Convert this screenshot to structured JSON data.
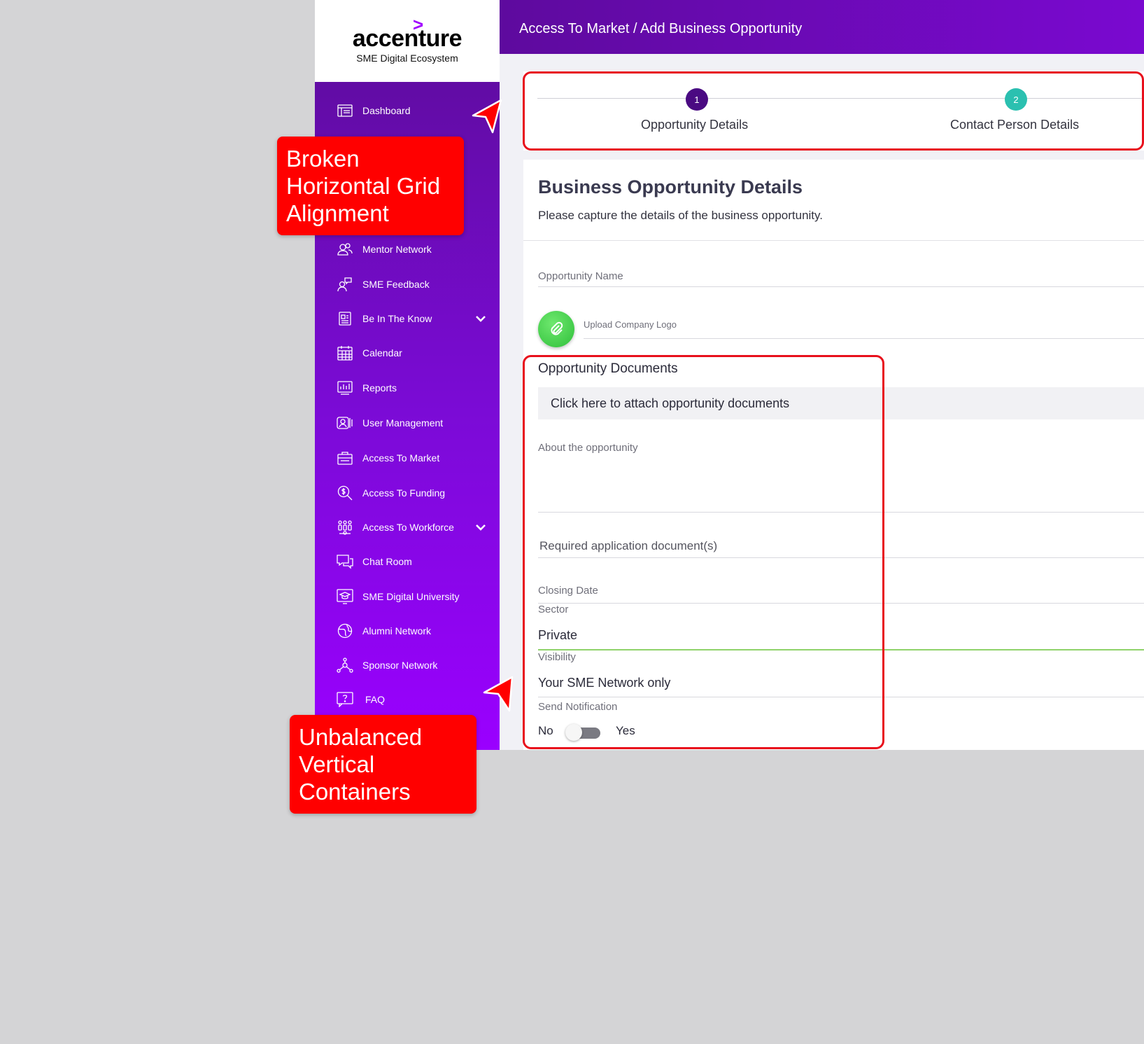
{
  "logo": {
    "mark": ">",
    "word": "accenture",
    "subtitle": "SME Digital Ecosystem"
  },
  "header": {
    "breadcrumb": "Access To Market / Add Business Opportunity"
  },
  "sidebar": {
    "items": [
      {
        "label": "Dashboard",
        "icon": "dashboard-icon"
      },
      {
        "label": "Mentor Network",
        "icon": "users-icon"
      },
      {
        "label": "SME Feedback",
        "icon": "feedback-icon"
      },
      {
        "label": "Be In The Know",
        "icon": "news-icon",
        "expandable": true
      },
      {
        "label": "Calendar",
        "icon": "calendar-icon"
      },
      {
        "label": "Reports",
        "icon": "reports-icon"
      },
      {
        "label": "User Management",
        "icon": "user-management-icon"
      },
      {
        "label": "Access To Market",
        "icon": "briefcase-icon"
      },
      {
        "label": "Access To Funding",
        "icon": "funding-icon"
      },
      {
        "label": "Access To Workforce",
        "icon": "workforce-icon",
        "expandable": true
      },
      {
        "label": "Chat Room",
        "icon": "chat-icon"
      },
      {
        "label": "SME Digital University",
        "icon": "university-icon"
      },
      {
        "label": "Alumni Network",
        "icon": "globe-icon"
      },
      {
        "label": "Sponsor Network",
        "icon": "network-icon"
      },
      {
        "label": "FAQ",
        "icon": "faq-icon"
      }
    ]
  },
  "stepper": {
    "steps": [
      {
        "number": "1",
        "label": "Opportunity Details",
        "color": "#4a0a82",
        "active": true
      },
      {
        "number": "2",
        "label": "Contact Person Details",
        "color": "#2bc0b0",
        "active": false
      }
    ]
  },
  "form": {
    "title": "Business Opportunity Details",
    "subtitle": "Please capture the details of the business opportunity.",
    "opportunity_name_label": "Opportunity Name",
    "upload_logo_label": "Upload Company Logo",
    "documents_label": "Opportunity Documents",
    "attach_text": "Click here to attach opportunity documents",
    "about_label": "About the opportunity",
    "required_docs_label": "Required application document(s)",
    "closing_date_label": "Closing Date",
    "sector_label": "Sector",
    "sector_value": "Private",
    "visibility_label": "Visibility",
    "visibility_value": "Your SME Network only",
    "notification_label": "Send Notification",
    "toggle_no": "No",
    "toggle_yes": "Yes",
    "notification_on": false
  },
  "annotations": [
    {
      "text": "Broken Horizontal Grid Alignment"
    },
    {
      "text": "Unbalanced Vertical Containers"
    }
  ],
  "colors": {
    "accent": "#a100ff",
    "annotation_red": "#ff0000",
    "toggle_off": "#7a7a82",
    "sector_underline": "#8fd36a"
  }
}
